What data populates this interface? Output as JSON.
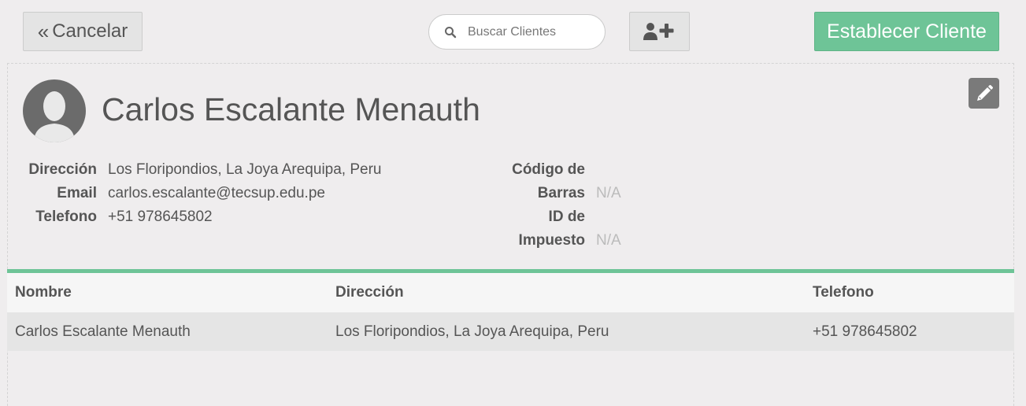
{
  "toolbar": {
    "cancel_label": "Cancelar",
    "search_placeholder": "Buscar Clientes",
    "establish_label": "Establecer Cliente"
  },
  "client": {
    "name": "Carlos Escalante Menauth",
    "fields": {
      "address_label": "Dirección",
      "address_value": "Los Floripondios, La Joya Arequipa, Peru",
      "email_label": "Email",
      "email_value": "carlos.escalante@tecsup.edu.pe",
      "phone_label": "Telefono",
      "phone_value": "+51 978645802",
      "barcode_label_1": "Código de",
      "barcode_label_2": "Barras",
      "barcode_value": "N/A",
      "taxid_label_1": "ID de",
      "taxid_label_2": "Impuesto",
      "taxid_value": "N/A"
    }
  },
  "table": {
    "headers": [
      "Nombre",
      "Dirección",
      "Telefono"
    ],
    "rows": [
      [
        "Carlos Escalante Menauth",
        "Los Floripondios, La Joya Arequipa, Peru",
        "+51 978645802"
      ]
    ]
  },
  "colors": {
    "accent": "#6ec497",
    "background": "#efedee"
  },
  "icons": [
    "chevrons-left-icon",
    "search-icon",
    "add-user-icon",
    "avatar-icon",
    "pencil-icon"
  ]
}
